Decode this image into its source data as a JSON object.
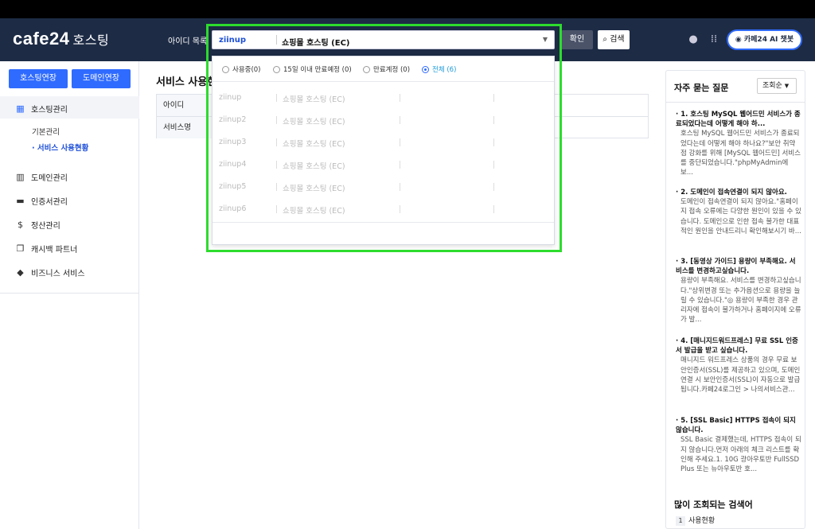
{
  "header": {
    "logo": "cafe24",
    "logo_sub": "호스팅",
    "id_list_label": "아이디 목록",
    "selected_id": "ziinup",
    "selected_service": "쇼핑몰 호스팅 (EC)",
    "confirm_label": "확인",
    "search_label": "검색",
    "ai_chat_label": "카페24 AI 챗봇"
  },
  "sidebar": {
    "hosting_extend": "호스팅연장",
    "domain_extend": "도메인연장",
    "items": [
      {
        "label": "호스팅관리",
        "icon": "grid-icon"
      },
      {
        "label": "도메인관리",
        "icon": "chart-icon"
      },
      {
        "label": "인증서관리",
        "icon": "briefcase-icon"
      },
      {
        "label": "정산관리",
        "icon": "dollar-icon"
      },
      {
        "label": "캐시백 파트너",
        "icon": "copy-icon"
      },
      {
        "label": "비즈니스 서비스",
        "icon": "diamond-icon"
      }
    ],
    "sub_items": [
      {
        "label": "기본관리"
      },
      {
        "label": "· 서비스 사용현황"
      }
    ]
  },
  "main": {
    "title": "서비스 사용현황",
    "rows": [
      {
        "label": "아이디"
      },
      {
        "label": "서비스명"
      }
    ]
  },
  "dropdown": {
    "filters": [
      {
        "label": "사용중(0)"
      },
      {
        "label": "15일 이내 만료예정 (0)"
      },
      {
        "label": "만료계정 (0)"
      },
      {
        "label": "전체 (6)"
      }
    ],
    "items": [
      {
        "id": "ziinup",
        "service": "쇼핑몰 호스팅 (EC)"
      },
      {
        "id": "ziinup2",
        "service": "쇼핑몰 호스팅 (EC)"
      },
      {
        "id": "ziinup3",
        "service": "쇼핑몰 호스팅 (EC)"
      },
      {
        "id": "ziinup4",
        "service": "쇼핑몰 호스팅 (EC)"
      },
      {
        "id": "ziinup5",
        "service": "쇼핑몰 호스팅 (EC)"
      },
      {
        "id": "ziinup6",
        "service": "쇼핑몰 호스팅 (EC)"
      }
    ]
  },
  "faq": {
    "title": "자주 묻는 질문",
    "sort": "조회순",
    "items": [
      {
        "q": "· 1. 호스팅 MySQL 웹어드민 서비스가 종료되었다는데 어떻게 해야 하...",
        "a": "호스팅 MySQL 웹어드민 서비스가 종료되었다는데 어떻게 해야 하나요?\"보안 취약점 강화를 위해 [MySQL 웹어드민] 서비스를 중단되었습니다.\"phpMyAdmin에 보..."
      },
      {
        "q": "· 2. 도메인이 접속연결이 되지 않아요.",
        "a": "도메인이 접속연결이 되지 않아요.\"홈페이지 접속 오류에는 다양한 원인이 있을 수 있습니다. 도메인으로 인한 접속 불가한 대표적인 원인을 안내드리니 확인해보시기 바..."
      },
      {
        "q": "· 3. [동영상 가이드] 용량이 부족해요. 서비스를 변경하고싶습니다.",
        "a": "용량이 부족해요. 서비스를 변경하고싶습니다.\"상위변경 또는 추가옵션으로 용량을 늘릴 수 있습니다.\"◎ 용량이 부족한 경우 관리자에 접속이 불가하거나 홈페이지에 오류가 발..."
      },
      {
        "q": "· 4. [매니지드워드프레스] 무료 SSL 인증서 발급을 받고 싶습니다.",
        "a": "매니지드 워드프레스 상품의 경우 무료 보안인증서(SSL)를 제공하고 있으며, 도메인 연결 시 보안인증서(SSL)이 자동으로 발급됩니다.카페24로그인 > 나의서비스관..."
      },
      {
        "q": "· 5. [SSL Basic] HTTPS 접속이 되지 않습니다.",
        "a": "SSL Basic 결제했는데, HTTPS 접속이 되지 않습니다.먼저 아래의 체크 리스트를 확인해 주세요.1. 10G 광아우토반 FullSSD Plus 또는 뉴아우토반 호..."
      }
    ],
    "popular_title": "많이 조회되는 검색어",
    "popular": [
      {
        "num": "1",
        "label": "사용현황"
      }
    ]
  },
  "colors": {
    "accent": "#2f6bff",
    "header": "#1d2b45",
    "highlight": "#2ddc2d"
  }
}
